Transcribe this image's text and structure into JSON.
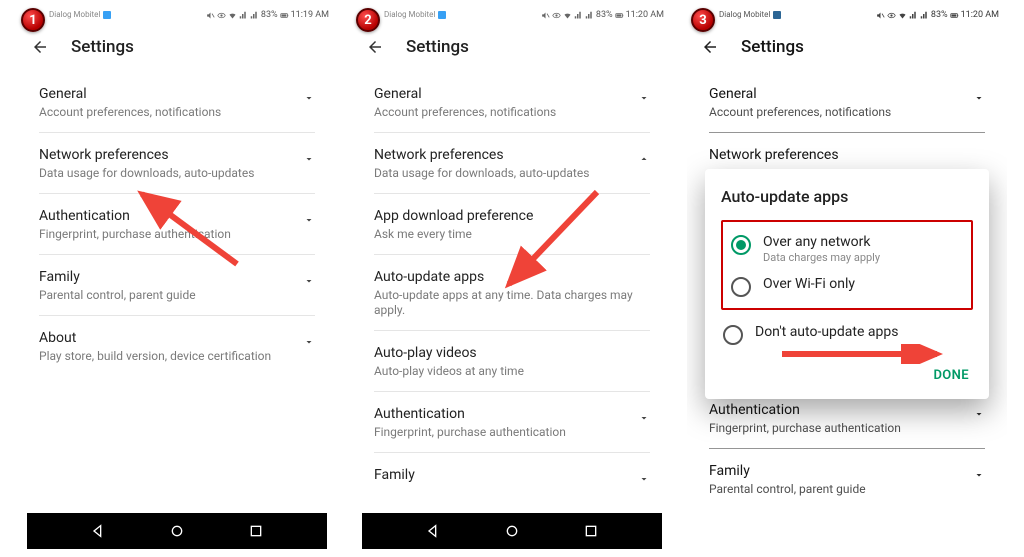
{
  "badges": [
    "1",
    "2",
    "3"
  ],
  "status": {
    "carrier": "Dialog\nMobitel",
    "battery": "83%",
    "times": [
      "11:19 AM",
      "11:20 AM",
      "11:20 AM"
    ]
  },
  "header": {
    "title": "Settings"
  },
  "screen1": {
    "items": [
      {
        "title": "General",
        "sub": "Account preferences, notifications",
        "chev": "down"
      },
      {
        "title": "Network preferences",
        "sub": "Data usage for downloads, auto-updates",
        "chev": "down"
      },
      {
        "title": "Authentication",
        "sub": "Fingerprint, purchase authentication",
        "chev": "down"
      },
      {
        "title": "Family",
        "sub": "Parental control, parent guide",
        "chev": "down"
      },
      {
        "title": "About",
        "sub": "Play store, build version, device certification",
        "chev": "down"
      }
    ]
  },
  "screen2": {
    "items": [
      {
        "title": "General",
        "sub": "Account preferences, notifications",
        "chev": "down"
      },
      {
        "title": "Network preferences",
        "sub": "Data usage for downloads, auto-updates",
        "chev": "up"
      },
      {
        "title": "App download preference",
        "sub": "Ask me every time",
        "chev": ""
      },
      {
        "title": "Auto-update apps",
        "sub": "Auto-update apps at any time. Data charges may apply.",
        "chev": ""
      },
      {
        "title": "Auto-play videos",
        "sub": "Auto-play videos at any time",
        "chev": ""
      },
      {
        "title": "Authentication",
        "sub": "Fingerprint, purchase authentication",
        "chev": "down"
      },
      {
        "title": "Family",
        "sub": "",
        "chev": "down"
      }
    ]
  },
  "screen3_bg": {
    "items": [
      {
        "title": "General",
        "sub": "Account preferences, notifications",
        "chev": "down"
      },
      {
        "title": "Network preferences",
        "sub": "",
        "chev": ""
      },
      {
        "title": "",
        "sub": "",
        "chev": ""
      },
      {
        "title": "",
        "sub": "",
        "chev": ""
      },
      {
        "title": "Authentication",
        "sub": "Fingerprint, purchase authentication",
        "chev": "down"
      },
      {
        "title": "Family",
        "sub": "Parental control, parent guide",
        "chev": "down"
      }
    ]
  },
  "dialog": {
    "title": "Auto-update apps",
    "options": [
      {
        "label": "Over any network",
        "sub": "Data charges may apply",
        "selected": true
      },
      {
        "label": "Over Wi-Fi only",
        "sub": "",
        "selected": false
      },
      {
        "label": "Don't auto-update apps",
        "sub": "",
        "selected": false
      }
    ],
    "done": "DONE"
  }
}
